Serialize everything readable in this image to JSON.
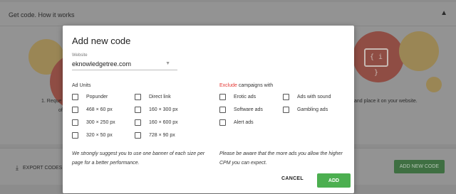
{
  "background": {
    "title": "Get code. How it works",
    "step1_line1": "1. Reque",
    "step1_line2": "of",
    "step3_text": "and place it on your website.",
    "icon_glyph": "{ i }",
    "export_label": "EXPORT CODES",
    "add_new_code_button": "ADD NEW CODE"
  },
  "modal": {
    "title": "Add new code",
    "website": {
      "label": "Website",
      "value": "eknowledgetree.com"
    },
    "ad_units": {
      "title": "Ad Units",
      "items": [
        {
          "label": "Popunder",
          "checked": false
        },
        {
          "label": "Direct link",
          "checked": false
        },
        {
          "label": "468 × 60 px",
          "checked": false
        },
        {
          "label": "160 × 300 px",
          "checked": false
        },
        {
          "label": "300 × 250 px",
          "checked": false
        },
        {
          "label": "160 × 600 px",
          "checked": false
        },
        {
          "label": "320 × 50 px",
          "checked": false
        },
        {
          "label": "728 × 90 px",
          "checked": false
        }
      ],
      "note": "We strongly suggest you to use one banner of each size per page for a better performance."
    },
    "exclude": {
      "title_highlight": "Exclude",
      "title_rest": " campaigns with",
      "items": [
        {
          "label": "Erotic ads",
          "checked": false
        },
        {
          "label": "Ads with sound",
          "checked": false
        },
        {
          "label": "Software ads",
          "checked": false
        },
        {
          "label": "Gambling ads",
          "checked": false
        },
        {
          "label": "Alert ads",
          "checked": false
        }
      ],
      "note": "Please be aware that the more ads you allow the higher CPM you can expect."
    },
    "cancel_label": "CANCEL",
    "add_label": "ADD"
  },
  "colors": {
    "accent_green": "#4caf50",
    "exclude_red": "#e53935"
  }
}
